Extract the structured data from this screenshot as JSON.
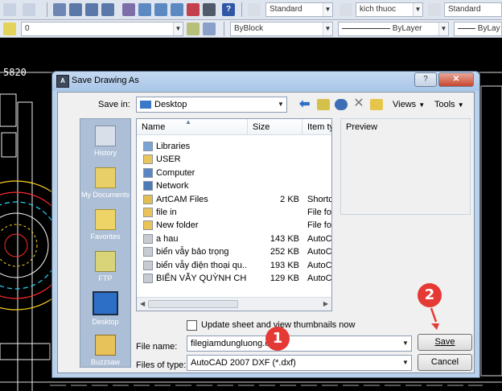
{
  "toolbar": {
    "text_style": "Standard",
    "dim_style": "kich thuoc",
    "table_style": "Standard"
  },
  "layer_bar": {
    "layer": "0",
    "color": "ByBlock",
    "linetype": "ByLayer",
    "lineweight": "ByLay"
  },
  "cad": {
    "coord_text": "5820"
  },
  "dialog": {
    "title": "Save Drawing As",
    "save_in_label": "Save in:",
    "save_in_value": "Desktop",
    "views_label": "Views",
    "tools_label": "Tools",
    "preview_label": "Preview",
    "columns": {
      "name": "Name",
      "size": "Size",
      "type": "Item ty"
    },
    "files": [
      {
        "name": "Libraries",
        "size": "",
        "type": "",
        "icon": "libraries-icon"
      },
      {
        "name": "USER",
        "size": "",
        "type": "",
        "icon": "user-folder-icon"
      },
      {
        "name": "Computer",
        "size": "",
        "type": "",
        "icon": "computer-icon"
      },
      {
        "name": "Network",
        "size": "",
        "type": "",
        "icon": "network-icon"
      },
      {
        "name": "ArtCAM Files",
        "size": "2 KB",
        "type": "Shortcu",
        "icon": "shortcut-icon"
      },
      {
        "name": "file in",
        "size": "",
        "type": "File fold",
        "icon": "folder-icon"
      },
      {
        "name": "New folder",
        "size": "",
        "type": "File fold",
        "icon": "folder-icon"
      },
      {
        "name": "a hau",
        "size": "143 KB",
        "type": "AutoCA",
        "icon": "dxf-icon"
      },
      {
        "name": "biển vẫy bảo trọng",
        "size": "252 KB",
        "type": "AutoCA",
        "icon": "dxf-icon"
      },
      {
        "name": "biển vẫy điện thoại qu...",
        "size": "193 KB",
        "type": "AutoCA",
        "icon": "dxf-icon"
      },
      {
        "name": "BIỂN VẪY QUỲNH CHI",
        "size": "129 KB",
        "type": "AutoCA",
        "icon": "dxf-icon"
      }
    ],
    "places": [
      "History",
      "My Documents",
      "Favorites",
      "FTP",
      "Desktop",
      "Buzzsaw"
    ],
    "update_thumbnails_label": "Update sheet and view thumbnails now",
    "file_name_label": "File name:",
    "file_name_value": "filegiamdungluong.dxf",
    "file_type_label": "Files of type:",
    "file_type_value": "AutoCAD 2007 DXF (*.dxf)",
    "save_button": "Save",
    "cancel_button": "Cancel"
  },
  "annotations": {
    "step1": "1",
    "step2": "2"
  },
  "colors": {
    "badge": "#e53935",
    "dialog_frame": "#b9d1ea",
    "places_bar": "#adbfd6"
  }
}
